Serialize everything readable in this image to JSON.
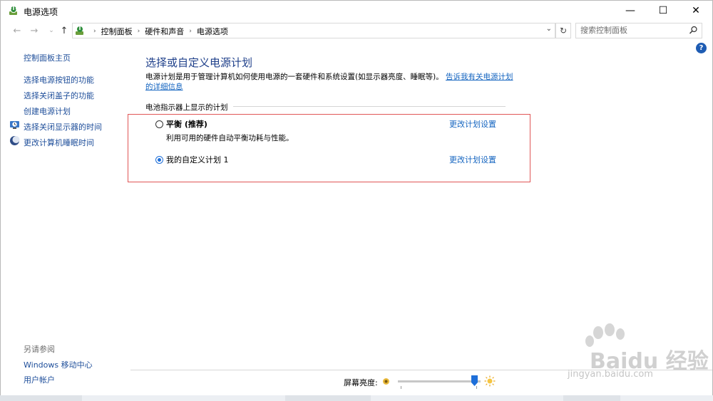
{
  "window": {
    "title": "电源选项",
    "controls": {
      "minimize": "—",
      "maximize": "☐",
      "close": "✕"
    }
  },
  "nav": {
    "back": "←",
    "forward": "→",
    "recent": "⌄",
    "up": "↑",
    "breadcrumbs": [
      "控制面板",
      "硬件和声音",
      "电源选项"
    ],
    "breadcrumb_sep": "›",
    "dropdown": "⌄",
    "refresh": "↻",
    "search_placeholder": "搜索控制面板"
  },
  "help": "?",
  "sidebar": {
    "home": "控制面板主页",
    "items": [
      {
        "label": "选择电源按钮的功能",
        "icon": "none"
      },
      {
        "label": "选择关闭盖子的功能",
        "icon": "none"
      },
      {
        "label": "创建电源计划",
        "icon": "none"
      },
      {
        "label": "选择关闭显示器的时间",
        "icon": "monitor-clock-icon"
      },
      {
        "label": "更改计算机睡眠时间",
        "icon": "moon-icon"
      }
    ],
    "see_also_title": "另请参阅",
    "see_also": [
      "Windows 移动中心",
      "用户帐户"
    ]
  },
  "main": {
    "title": "选择或自定义电源计划",
    "desc_text": "电源计划是用于管理计算机如何使用电源的一套硬件和系统设置(如显示器亮度、睡眠等)。",
    "desc_link": "告诉我有关电源计划的详细信息",
    "group_label": "电池指示器上显示的计划",
    "plans": [
      {
        "name": "平衡 (推荐)",
        "description": "利用可用的硬件自动平衡功耗与性能。",
        "selected": false,
        "link": "更改计划设置"
      },
      {
        "name": "我的自定义计划 1",
        "description": "",
        "selected": true,
        "link": "更改计划设置"
      }
    ]
  },
  "brightness": {
    "label": "屏幕亮度:",
    "level": 0.93
  },
  "watermark": {
    "brand": "Bai",
    "brand2": "du",
    "cn": "经验",
    "url": "jingyan.baidu.com"
  },
  "colors": {
    "link": "#1565c0",
    "title": "#1e3f8a",
    "highlight_border": "#e05656",
    "radio_selected": "#1e6fd9"
  }
}
